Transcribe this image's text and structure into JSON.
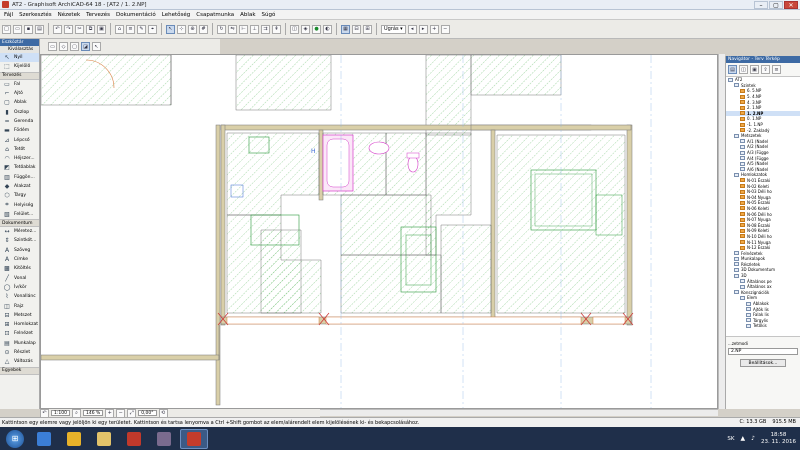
{
  "window": {
    "title": "AT2 - Graphisoft ArchiCAD-64 18 - [AT2 / 1. 2.NP]",
    "controls": [
      "–",
      "▢",
      "✕"
    ]
  },
  "menu": [
    "Fájl",
    "Szerkesztés",
    "Nézetek",
    "Tervezés",
    "Dokumentáció",
    "Lehetőség",
    "Csapatmunka",
    "Ablak",
    "Súgó"
  ],
  "toolbar": {
    "ugras_label": "Ugrás"
  },
  "toolbox": {
    "header": "Eszköztár",
    "selector": "Kiválasztás",
    "arrow_item": "Nyíl",
    "frame_item": "Kijelölő",
    "section_design": "Tervezés",
    "design_items": [
      "Fal",
      "Ajtó",
      "Ablak",
      "Oszlop",
      "Gerenda",
      "Födém",
      "Lépcső",
      "Tetőt",
      "Héjszer...",
      "Tetőablak",
      "Függön...",
      "Alakzat",
      "Tárgy",
      "Helyiség",
      "Felület..."
    ],
    "section_doc": "Dokumentum",
    "doc_items": [
      "Méretez...",
      "Szintkót...",
      "Szöveg",
      "Címke",
      "Kitöltés",
      "Vonal",
      "Ív/kör",
      "Vonallánc",
      "Rajz",
      "Metszet",
      "Homlokzat",
      "Felnézet",
      "Munkalap",
      "Részlet",
      "Változás"
    ],
    "section_more": "Egyebek"
  },
  "statusbar": {
    "scale": "1:100",
    "zoom": "146 %",
    "angle": "0,00°"
  },
  "navigator": {
    "header": "Navigátor - Terv Térkép",
    "tree": [
      {
        "label": "AT2",
        "level": 0,
        "orange": false,
        "active": false
      },
      {
        "label": "Szintek",
        "level": 1,
        "orange": false,
        "active": false
      },
      {
        "label": "6. 5.NP",
        "level": 2,
        "orange": true,
        "active": false
      },
      {
        "label": "5. 4.NP",
        "level": 2,
        "orange": true,
        "active": false
      },
      {
        "label": "4. 3.NP",
        "level": 2,
        "orange": true,
        "active": false
      },
      {
        "label": "2. 1.NP",
        "level": 2,
        "orange": true,
        "active": false
      },
      {
        "label": "1. 2.NP",
        "level": 2,
        "orange": true,
        "active": true
      },
      {
        "label": "0. 1.NP",
        "level": 2,
        "orange": true,
        "active": false
      },
      {
        "label": "-1. 1.NP",
        "level": 2,
        "orange": true,
        "active": false
      },
      {
        "label": "-2. Zakladý",
        "level": 2,
        "orange": true,
        "active": false
      },
      {
        "label": "Metszetek",
        "level": 1,
        "orange": false,
        "active": false
      },
      {
        "label": "A/1 (Nadel",
        "level": 2,
        "orange": false,
        "active": false
      },
      {
        "label": "A/2 (Nadel",
        "level": 2,
        "orange": false,
        "active": false
      },
      {
        "label": "A/3 (Függe",
        "level": 2,
        "orange": false,
        "active": false
      },
      {
        "label": "A/4 (Függe",
        "level": 2,
        "orange": false,
        "active": false
      },
      {
        "label": "A/5 (Nadel",
        "level": 2,
        "orange": false,
        "active": false
      },
      {
        "label": "A/6 (Nadel",
        "level": 2,
        "orange": false,
        "active": false
      },
      {
        "label": "Homlokzatok",
        "level": 1,
        "orange": false,
        "active": false
      },
      {
        "label": "N-01 Északi",
        "level": 2,
        "orange": true,
        "active": false
      },
      {
        "label": "N-02 Keleti",
        "level": 2,
        "orange": true,
        "active": false
      },
      {
        "label": "N-03 Déli ho",
        "level": 2,
        "orange": true,
        "active": false
      },
      {
        "label": "N-04 Nyuga",
        "level": 2,
        "orange": true,
        "active": false
      },
      {
        "label": "N-05 Északi",
        "level": 2,
        "orange": true,
        "active": false
      },
      {
        "label": "N-06 Keleti",
        "level": 2,
        "orange": true,
        "active": false
      },
      {
        "label": "N-06 Déli ho",
        "level": 2,
        "orange": true,
        "active": false
      },
      {
        "label": "N-07 Nyuga",
        "level": 2,
        "orange": true,
        "active": false
      },
      {
        "label": "N-08 Északi",
        "level": 2,
        "orange": true,
        "active": false
      },
      {
        "label": "N-09 Keleti",
        "level": 2,
        "orange": true,
        "active": false
      },
      {
        "label": "N-10 Déli ho",
        "level": 2,
        "orange": true,
        "active": false
      },
      {
        "label": "N-11 Nyuga",
        "level": 2,
        "orange": true,
        "active": false
      },
      {
        "label": "N-12 Északi",
        "level": 2,
        "orange": true,
        "active": false
      },
      {
        "label": "Felnézetek",
        "level": 1,
        "orange": false,
        "active": false
      },
      {
        "label": "Munkalapok",
        "level": 1,
        "orange": false,
        "active": false
      },
      {
        "label": "Részletek",
        "level": 1,
        "orange": false,
        "active": false
      },
      {
        "label": "3D Dokumentum",
        "level": 1,
        "orange": false,
        "active": false
      },
      {
        "label": "3D",
        "level": 1,
        "orange": false,
        "active": false
      },
      {
        "label": "Általános pe",
        "level": 2,
        "orange": false,
        "active": false
      },
      {
        "label": "Általános ax",
        "level": 2,
        "orange": false,
        "active": false
      },
      {
        "label": "Konszignációk",
        "level": 1,
        "orange": false,
        "active": false
      },
      {
        "label": "Elem",
        "level": 2,
        "orange": false,
        "active": false
      },
      {
        "label": "Ablakok",
        "level": 3,
        "orange": false,
        "active": false
      },
      {
        "label": "Ajtók lis",
        "level": 3,
        "orange": false,
        "active": false
      },
      {
        "label": "Falak lis",
        "level": 3,
        "orange": false,
        "active": false
      },
      {
        "label": "Tárgylis",
        "level": 3,
        "orange": false,
        "active": false
      },
      {
        "label": "Tetőkis",
        "level": 3,
        "orange": false,
        "active": false
      }
    ],
    "footer_label": "...zetmodi",
    "story_field": "2.NP",
    "settings_button": "Beállítások..."
  },
  "message": "Kattintson egy elemre vagy jelöljön ki egy területet. Kattintson és tartsa lenyomva a Ctrl +Shift gombot az elem/alárendelt elem kijelölésének ki- és bekapcsolásához.",
  "disk": {
    "c": "C: 13.3 GB",
    "mem": "915.5 MB"
  },
  "taskbar": {
    "language": "SK",
    "time": "18:58",
    "date": "23. 11. 2016",
    "apps": [
      {
        "name": "explorer",
        "color": "#3b7ed6"
      },
      {
        "name": "chrome",
        "color": "#e8b22a"
      },
      {
        "name": "folder",
        "color": "#e3c36a"
      },
      {
        "name": "media",
        "color": "#c0392b"
      },
      {
        "name": "photo",
        "color": "#7a6b8e"
      },
      {
        "name": "archicad",
        "color": "#c43c2c"
      }
    ]
  },
  "colors": {
    "wall": "#d9cfa8",
    "hatch": "#4caf50",
    "pink": "#d43ac8",
    "cut": "#cc3333"
  }
}
